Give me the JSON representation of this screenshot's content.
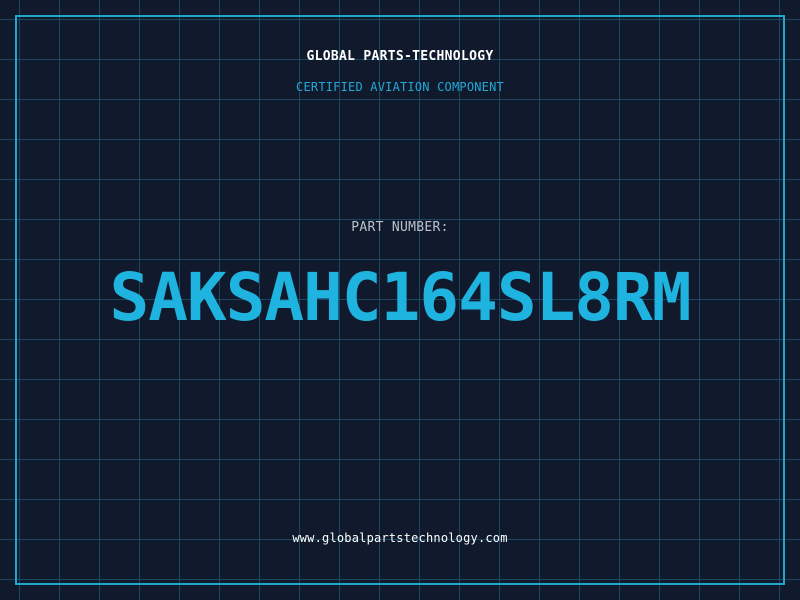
{
  "header": {
    "company_name": "GLOBAL PARTS-TECHNOLOGY",
    "tagline": "CERTIFIED AVIATION COMPONENT"
  },
  "part": {
    "label": "PART NUMBER:",
    "number": "SAKSAHC164SL8RM"
  },
  "footer": {
    "website": "www.globalpartstechnology.com"
  },
  "colors": {
    "background": "#111a2c",
    "grid": "#226e8c",
    "border": "#1fa7c9",
    "accent": "#1eb4df",
    "label": "#b9c1cc",
    "text": "#ffffff"
  }
}
